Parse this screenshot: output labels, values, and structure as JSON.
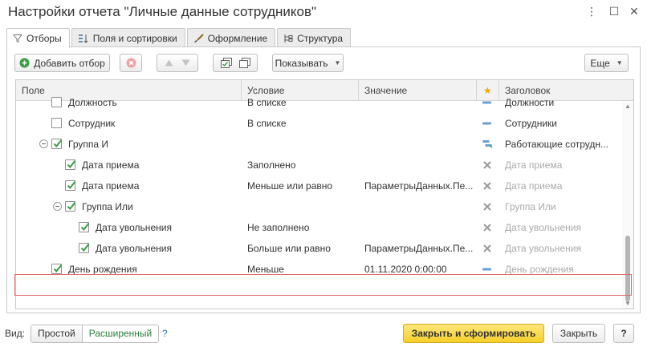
{
  "window": {
    "title": "Настройки отчета \"Личные данные сотрудников\"",
    "more_glyph": "⋮",
    "maximize_glyph": "☐",
    "close_glyph": "✕"
  },
  "tabs": [
    {
      "label": "Отборы",
      "icon": "filter-icon"
    },
    {
      "label": "Поля и сортировки",
      "icon": "fields-sort-icon"
    },
    {
      "label": "Оформление",
      "icon": "brush-icon"
    },
    {
      "label": "Структура",
      "icon": "structure-icon"
    }
  ],
  "toolbar": {
    "add_filter": "Добавить отбор",
    "show": "Показывать",
    "more": "Еще",
    "dropdown_arrow": "▼"
  },
  "grid": {
    "columns": {
      "field": "Поле",
      "condition": "Условие",
      "value": "Значение",
      "title": "Заголовок",
      "star": "★"
    },
    "rows": [
      {
        "field": "Должность",
        "condition": "В списке",
        "value": "",
        "title": "Должности",
        "checked": false,
        "status": "dash"
      },
      {
        "field": "Сотрудник",
        "condition": "В списке",
        "value": "",
        "title": "Сотрудники",
        "checked": false,
        "status": "dash"
      },
      {
        "field": "Группа И",
        "condition": "",
        "value": "",
        "title": "Работающие сотрудн...",
        "checked": true,
        "status": "group"
      },
      {
        "field": "Дата приема",
        "condition": "Заполнено",
        "value": "",
        "title": "Дата приема",
        "checked": true,
        "status": "x"
      },
      {
        "field": "Дата приема",
        "condition": "Меньше или равно",
        "value": "ПараметрыДанных.Пе...",
        "title": "Дата приема",
        "checked": true,
        "status": "x"
      },
      {
        "field": "Группа Или",
        "condition": "",
        "value": "",
        "title": "Группа Или",
        "checked": true,
        "status": "x"
      },
      {
        "field": "Дата увольнения",
        "condition": "Не заполнено",
        "value": "",
        "title": "Дата увольнения",
        "checked": true,
        "status": "x"
      },
      {
        "field": "Дата увольнения",
        "condition": "Больше или равно",
        "value": "ПараметрыДанных.Пе...",
        "title": "Дата увольнения",
        "checked": true,
        "status": "x"
      },
      {
        "field": "День рождения",
        "condition": "Меньше",
        "value": "01.11.2020 0:00:00",
        "title": "День рождения",
        "checked": true,
        "status": "dash"
      }
    ]
  },
  "footer": {
    "view_label": "Вид:",
    "simple": "Простой",
    "advanced": "Расширенный",
    "help": "?",
    "close_and_build": "Закрыть и сформировать",
    "close": "Закрыть",
    "help_button": "?"
  },
  "colors": {
    "accent_green": "#2a7d3a",
    "check_green": "#3a9b46",
    "primary_button": "#f6cf2c",
    "highlight_border": "#e26a6a",
    "star": "#f0a800"
  }
}
